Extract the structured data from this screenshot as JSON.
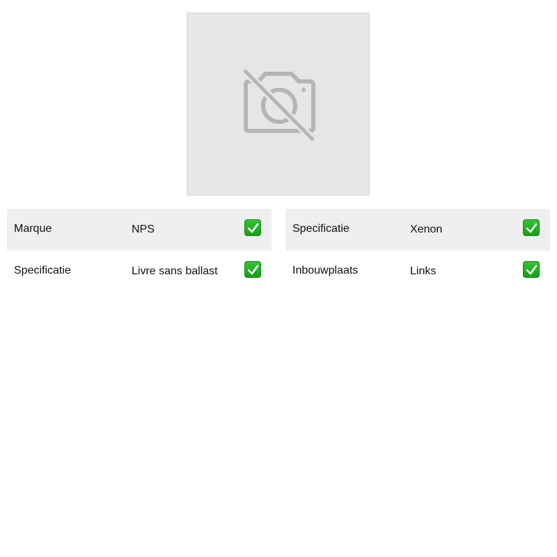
{
  "product": {
    "image": {
      "icon": "no-camera-icon",
      "background_color": "#e6e6e6",
      "icon_color": "#b5b5b5"
    }
  },
  "specifications": {
    "left": [
      {
        "label": "Marque",
        "value": "NPS",
        "check_icon": "check-icon"
      },
      {
        "label": "Specificatie",
        "value": "Livre sans ballast",
        "check_icon": "check-icon"
      }
    ],
    "right": [
      {
        "label": "Specificatie",
        "value": "Xenon",
        "check_icon": "check-icon"
      },
      {
        "label": "Inbouwplaats",
        "value": "Links",
        "check_icon": "check-icon"
      }
    ]
  },
  "colors": {
    "row_shade": "#efefef",
    "check_green": "#16a316"
  }
}
